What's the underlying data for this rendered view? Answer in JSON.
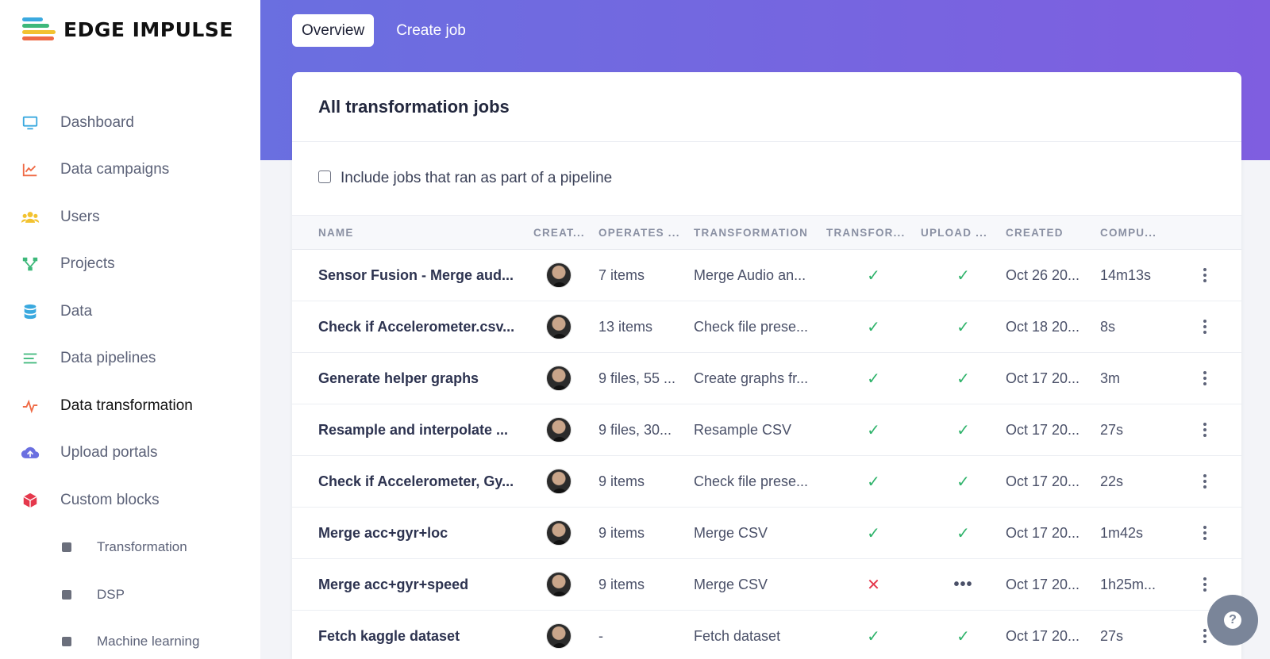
{
  "brand": {
    "name": "EDGE IMPULSE"
  },
  "sidebar": {
    "items": [
      {
        "label": "Dashboard",
        "icon": "monitor-icon",
        "color": "#3aa9df"
      },
      {
        "label": "Data campaigns",
        "icon": "line-chart-icon",
        "color": "#ef6a45"
      },
      {
        "label": "Users",
        "icon": "users-icon",
        "color": "#f2c230"
      },
      {
        "label": "Projects",
        "icon": "project-tree-icon",
        "color": "#3db87a"
      },
      {
        "label": "Data",
        "icon": "database-icon",
        "color": "#3aa9df"
      },
      {
        "label": "Data pipelines",
        "icon": "pipeline-lines-icon",
        "color": "#3db87a"
      },
      {
        "label": "Data transformation",
        "icon": "pulse-icon",
        "color": "#ef6a45",
        "active": true
      },
      {
        "label": "Upload portals",
        "icon": "cloud-upload-icon",
        "color": "#6a6fe0"
      },
      {
        "label": "Custom blocks",
        "icon": "cube-icon",
        "color": "#e5384c"
      }
    ],
    "subitems": [
      {
        "label": "Transformation"
      },
      {
        "label": "DSP"
      },
      {
        "label": "Machine learning"
      }
    ]
  },
  "tabs": [
    {
      "label": "Overview",
      "active": true
    },
    {
      "label": "Create job",
      "active": false
    }
  ],
  "card": {
    "title": "All transformation jobs",
    "filter_label": "Include jobs that ran as part of a pipeline",
    "filter_checked": false
  },
  "table": {
    "headers": [
      "NAME",
      "CREAT...",
      "OPERATES ...",
      "TRANSFORMATION",
      "TRANSFOR...",
      "UPLOAD ...",
      "CREATED",
      "COMPU..."
    ],
    "rows": [
      {
        "name": "Sensor Fusion - Merge aud...",
        "operates": "7 items",
        "transformation": "Merge Audio an...",
        "transform_status": "success",
        "upload_status": "success",
        "created": "Oct 26 20...",
        "compute": "14m13s"
      },
      {
        "name": "Check if Accelerometer.csv...",
        "operates": "13 items",
        "transformation": "Check file prese...",
        "transform_status": "success",
        "upload_status": "success",
        "created": "Oct 18 20...",
        "compute": "8s"
      },
      {
        "name": "Generate helper graphs",
        "operates": "9 files, 55 ...",
        "transformation": "Create graphs fr...",
        "transform_status": "success",
        "upload_status": "success",
        "created": "Oct 17 20...",
        "compute": "3m"
      },
      {
        "name": "Resample and interpolate ...",
        "operates": "9 files, 30...",
        "transformation": "Resample CSV",
        "transform_status": "success",
        "upload_status": "success",
        "created": "Oct 17 20...",
        "compute": "27s"
      },
      {
        "name": "Check if Accelerometer, Gy...",
        "operates": "9 items",
        "transformation": "Check file prese...",
        "transform_status": "success",
        "upload_status": "success",
        "created": "Oct 17 20...",
        "compute": "22s"
      },
      {
        "name": "Merge acc+gyr+loc",
        "operates": "9 items",
        "transformation": "Merge CSV",
        "transform_status": "success",
        "upload_status": "success",
        "created": "Oct 17 20...",
        "compute": "1m42s"
      },
      {
        "name": "Merge acc+gyr+speed",
        "operates": "9 items",
        "transformation": "Merge CSV",
        "transform_status": "failed",
        "upload_status": "pending",
        "created": "Oct 17 20...",
        "compute": "1h25m..."
      },
      {
        "name": "Fetch kaggle dataset",
        "operates": "-",
        "transformation": "Fetch dataset",
        "transform_status": "success",
        "upload_status": "success",
        "created": "Oct 17 20...",
        "compute": "27s"
      }
    ]
  },
  "status_symbols": {
    "success": "✓",
    "failed": "✕",
    "pending": "•••"
  },
  "help": {
    "icon": "question-icon",
    "symbol": "?"
  }
}
